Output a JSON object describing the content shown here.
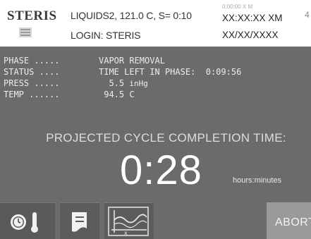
{
  "header": {
    "logo": "STERIS",
    "cycle": "LIQUIDS2, 121.0 C, S= 0:10",
    "login": "LOGIN: STERIS",
    "time_faint": "0:00:00 X M",
    "time": "XX:XX:XX XM",
    "date": "XX/XX/XXXX",
    "corner": "4"
  },
  "status": [
    {
      "label": "PHASE .....",
      "value": "VAPOR REMOVAL"
    },
    {
      "label": "STATUS ....",
      "value": "TIME LEFT IN PHASE:  0:09:56"
    },
    {
      "label": "PRESS .....",
      "value": "  5.5 ",
      "unit": "inHg"
    },
    {
      "label": "TEMP ......",
      "value": " 94.5 C"
    }
  ],
  "projected": {
    "label": "PROJECTED CYCLE COMPLETION TIME:",
    "time": "0:28",
    "unit": "hours:minutes"
  },
  "buttons": {
    "temp_icon": "clock-thermometer-icon",
    "doc_icon": "document-icon",
    "chart_icon": "chart-icon",
    "abort": "ABORT"
  }
}
